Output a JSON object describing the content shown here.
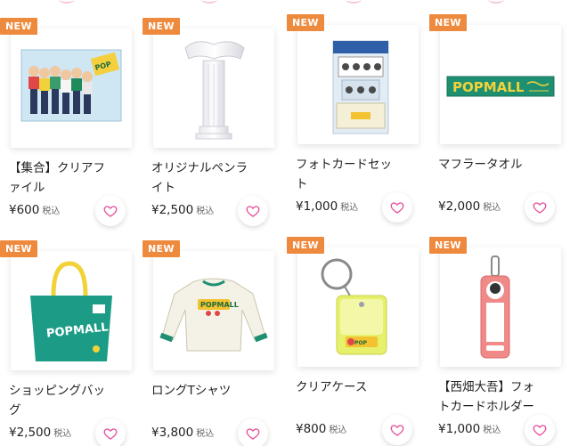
{
  "products": [
    {
      "badge": "NEW",
      "name": "【集合】クリアファイル",
      "price": "¥600",
      "tax": "税込",
      "icon": "clear-file-image"
    },
    {
      "badge": "NEW",
      "name": "オリジナルペンライト",
      "price": "¥2,500",
      "tax": "税込",
      "icon": "penlight-image"
    },
    {
      "badge": "NEW",
      "name": "フォトカードセット",
      "price": "¥1,000",
      "tax": "税込",
      "icon": "photocard-set-image"
    },
    {
      "badge": "NEW",
      "name": "マフラータオル",
      "price": "¥2,000",
      "tax": "税込",
      "icon": "muffler-towel-image"
    },
    {
      "badge": "NEW",
      "name": "ショッピングバッグ",
      "price": "¥2,500",
      "tax": "税込",
      "icon": "shopping-bag-image"
    },
    {
      "badge": "NEW",
      "name": "ロングTシャツ",
      "price": "¥3,800",
      "tax": "税込",
      "icon": "long-tshirt-image"
    },
    {
      "badge": "NEW",
      "name": "クリアケース",
      "price": "¥800",
      "tax": "税込",
      "icon": "clear-case-image"
    },
    {
      "badge": "NEW",
      "name": "【西畑大吾】フォトカードホルダー",
      "price": "¥1,000",
      "tax": "税込",
      "icon": "photocard-holder-image"
    }
  ],
  "towel_logo": "POPMALL",
  "colors": {
    "badge": "#ee8a3e",
    "heart": "#e7509a"
  }
}
